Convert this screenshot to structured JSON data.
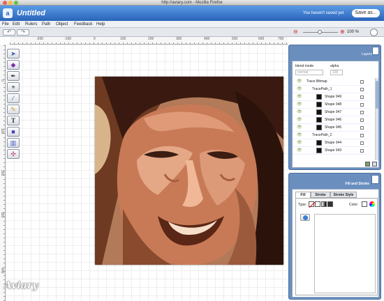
{
  "window": {
    "title": "http://aviary.com - Mozilla Firefox"
  },
  "app": {
    "logo": "a",
    "document_title": "Untitled",
    "unsaved_text": "You haven't saved yet",
    "save_label": "Save as..."
  },
  "menu": {
    "items": [
      "File",
      "Edit",
      "Rulers",
      "Path",
      "Object",
      "Feedback",
      "Help"
    ]
  },
  "toolbar": {
    "undo_label": "↶",
    "redo_label": "↷",
    "zoom_percent": "100 %",
    "zoom_level": 0.45
  },
  "ruler": {
    "top": [
      "-200",
      "-100",
      "0",
      "100",
      "200",
      "300",
      "400",
      "500",
      "600",
      "700"
    ],
    "left": [
      "0",
      "100",
      "200",
      "300",
      "400"
    ]
  },
  "tools": [
    {
      "name": "select-tool",
      "icon": "arrow-icon",
      "glyph": "➤"
    },
    {
      "name": "node-tool",
      "icon": "node-icon",
      "glyph": "◆"
    },
    {
      "name": "pen-tool",
      "icon": "pen-icon",
      "glyph": "✒"
    },
    {
      "name": "eyedropper-tool",
      "icon": "eyedropper-icon",
      "glyph": "⌖"
    },
    {
      "name": "brush-tool",
      "icon": "brush-icon",
      "glyph": "⁄"
    },
    {
      "name": "pencil-tool",
      "icon": "pencil-icon",
      "glyph": "✎"
    },
    {
      "name": "text-tool",
      "icon": "text-icon",
      "glyph": "T"
    },
    {
      "name": "rectangle-tool",
      "icon": "rectangle-icon",
      "glyph": "■"
    },
    {
      "name": "gradient-tool",
      "icon": "gradient-icon",
      "glyph": "▥"
    },
    {
      "name": "transform-tool",
      "icon": "transform-icon",
      "glyph": "✣"
    }
  ],
  "layers_panel": {
    "title": "Layers",
    "blend_mode_label": "blend mode",
    "blend_mode_value": "normal",
    "alpha_label": "alpha",
    "alpha_value": "100",
    "rows": [
      {
        "label": "Trace Bitmap",
        "indent": 0,
        "type": "folder"
      },
      {
        "label": "TracePath_1",
        "indent": 1,
        "type": "folder"
      },
      {
        "label": "Shape 949",
        "indent": 2,
        "type": "shape"
      },
      {
        "label": "Shape 948",
        "indent": 2,
        "type": "shape"
      },
      {
        "label": "Shape 947",
        "indent": 2,
        "type": "shape"
      },
      {
        "label": "Shape 946",
        "indent": 2,
        "type": "shape"
      },
      {
        "label": "Shape 945",
        "indent": 2,
        "type": "shape"
      },
      {
        "label": "TracePath_2",
        "indent": 1,
        "type": "folder"
      },
      {
        "label": "Shape 944",
        "indent": 2,
        "type": "shape"
      },
      {
        "label": "Shape 943",
        "indent": 2,
        "type": "shape"
      }
    ]
  },
  "fill_panel": {
    "title": "Fill and Stroke",
    "tabs": [
      "Fill",
      "Stroke",
      "Stroke Style"
    ],
    "type_label": "Type:",
    "color_label": "Color:"
  },
  "colors": {
    "header": "#3f7fd2",
    "panel": "#6a8fbf"
  },
  "watermark": "Aviary"
}
